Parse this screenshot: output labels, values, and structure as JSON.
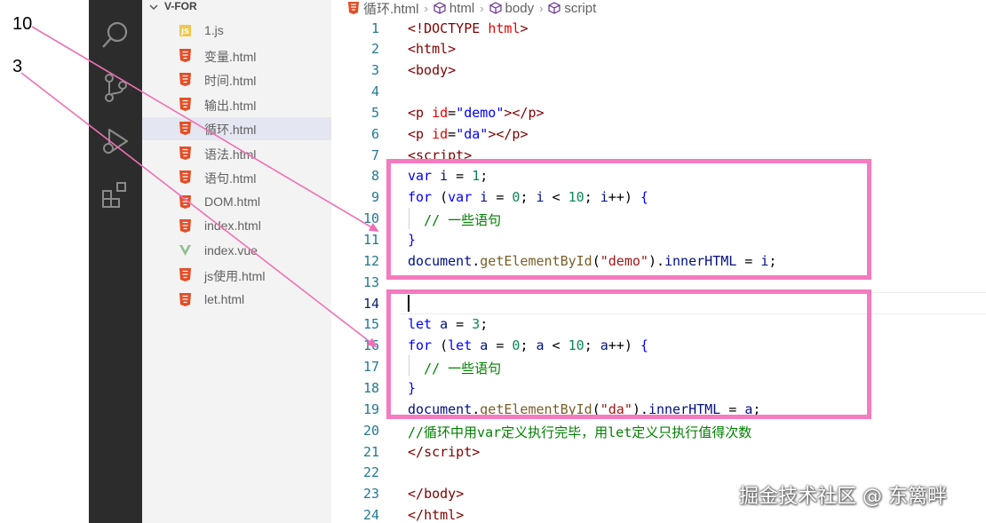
{
  "annotations": {
    "arrow_label_1": "10",
    "arrow_label_2": "3"
  },
  "activity_bar": {
    "icons": [
      "search-icon",
      "source-control-icon",
      "run-debug-icon",
      "extensions-icon"
    ]
  },
  "explorer": {
    "title": "V-FOR",
    "files": [
      {
        "name": "1.js",
        "type": "js"
      },
      {
        "name": "变量.html",
        "type": "html"
      },
      {
        "name": "时间.html",
        "type": "html"
      },
      {
        "name": "输出.html",
        "type": "html"
      },
      {
        "name": "循环.html",
        "type": "html",
        "active": true
      },
      {
        "name": "语法.html",
        "type": "html"
      },
      {
        "name": "语句.html",
        "type": "html"
      },
      {
        "name": "DOM.html",
        "type": "html"
      },
      {
        "name": "index.html",
        "type": "html"
      },
      {
        "name": "index.vue",
        "type": "vue"
      },
      {
        "name": "js使用.html",
        "type": "html"
      },
      {
        "name": "let.html",
        "type": "html"
      }
    ]
  },
  "breadcrumb": {
    "file": "循环.html",
    "crumb1": "html",
    "crumb2": "body",
    "crumb3": "script"
  },
  "editor": {
    "current_line": 14,
    "lines": [
      {
        "n": "1",
        "tokens": [
          [
            "punct",
            "<!"
          ],
          [
            "tag",
            "DOCTYPE "
          ],
          [
            "attr",
            "html"
          ],
          [
            "punct",
            ">"
          ]
        ]
      },
      {
        "n": "2",
        "tokens": [
          [
            "punct",
            "<"
          ],
          [
            "tag",
            "html"
          ],
          [
            "punct",
            ">"
          ]
        ]
      },
      {
        "n": "3",
        "tokens": [
          [
            "punct",
            "<"
          ],
          [
            "tag",
            "body"
          ],
          [
            "punct",
            ">"
          ]
        ]
      },
      {
        "n": "4",
        "tokens": []
      },
      {
        "n": "5",
        "tokens": [
          [
            "punct",
            "<"
          ],
          [
            "tag",
            "p "
          ],
          [
            "attr",
            "id"
          ],
          [
            "plain",
            "="
          ],
          [
            "str",
            "\"demo\""
          ],
          [
            "punct",
            "></"
          ],
          [
            "tag",
            "p"
          ],
          [
            "punct",
            ">"
          ]
        ]
      },
      {
        "n": "6",
        "tokens": [
          [
            "punct",
            "<"
          ],
          [
            "tag",
            "p "
          ],
          [
            "attr",
            "id"
          ],
          [
            "plain",
            "="
          ],
          [
            "str",
            "\"da\""
          ],
          [
            "punct",
            "></"
          ],
          [
            "tag",
            "p"
          ],
          [
            "punct",
            ">"
          ]
        ]
      },
      {
        "n": "7",
        "tokens": [
          [
            "punct",
            "<"
          ],
          [
            "tag",
            "script"
          ],
          [
            "punct",
            ">"
          ]
        ]
      },
      {
        "n": "8",
        "tokens": [
          [
            "kw",
            "var "
          ],
          [
            "var",
            "i"
          ],
          [
            "plain",
            " = "
          ],
          [
            "num",
            "1"
          ],
          [
            "plain",
            ";"
          ]
        ]
      },
      {
        "n": "9",
        "tokens": [
          [
            "kw",
            "for "
          ],
          [
            "plain",
            "("
          ],
          [
            "kw",
            "var "
          ],
          [
            "var",
            "i"
          ],
          [
            "plain",
            " = "
          ],
          [
            "num",
            "0"
          ],
          [
            "plain",
            "; "
          ],
          [
            "var",
            "i"
          ],
          [
            "plain",
            " < "
          ],
          [
            "num",
            "10"
          ],
          [
            "plain",
            "; "
          ],
          [
            "var",
            "i"
          ],
          [
            "plain",
            "++) "
          ],
          [
            "kw",
            "{"
          ]
        ]
      },
      {
        "n": "10",
        "tokens": [
          [
            "plain",
            "  "
          ],
          [
            "cmt",
            "// 一些语句"
          ]
        ]
      },
      {
        "n": "11",
        "tokens": [
          [
            "kw",
            "}"
          ]
        ]
      },
      {
        "n": "12",
        "tokens": [
          [
            "var",
            "document"
          ],
          [
            "plain",
            "."
          ],
          [
            "fn",
            "getElementById"
          ],
          [
            "plain",
            "("
          ],
          [
            "strd",
            "\"demo\""
          ],
          [
            "plain",
            ")."
          ],
          [
            "var",
            "innerHTML"
          ],
          [
            "plain",
            " = "
          ],
          [
            "var",
            "i"
          ],
          [
            "plain",
            ";"
          ]
        ]
      },
      {
        "n": "13",
        "tokens": []
      },
      {
        "n": "14",
        "tokens": []
      },
      {
        "n": "15",
        "tokens": [
          [
            "kw",
            "let "
          ],
          [
            "var",
            "a"
          ],
          [
            "plain",
            " = "
          ],
          [
            "num",
            "3"
          ],
          [
            "plain",
            ";"
          ]
        ]
      },
      {
        "n": "16",
        "tokens": [
          [
            "kw",
            "for "
          ],
          [
            "plain",
            "("
          ],
          [
            "kw",
            "let "
          ],
          [
            "var",
            "a"
          ],
          [
            "plain",
            " = "
          ],
          [
            "num",
            "0"
          ],
          [
            "plain",
            "; "
          ],
          [
            "var",
            "a"
          ],
          [
            "plain",
            " < "
          ],
          [
            "num",
            "10"
          ],
          [
            "plain",
            "; "
          ],
          [
            "var",
            "a"
          ],
          [
            "plain",
            "++) "
          ],
          [
            "kw",
            "{"
          ]
        ]
      },
      {
        "n": "17",
        "tokens": [
          [
            "plain",
            "  "
          ],
          [
            "cmt",
            "// 一些语句"
          ]
        ]
      },
      {
        "n": "18",
        "tokens": [
          [
            "kw",
            "}"
          ]
        ]
      },
      {
        "n": "19",
        "tokens": [
          [
            "var",
            "document"
          ],
          [
            "plain",
            "."
          ],
          [
            "fn",
            "getElementById"
          ],
          [
            "plain",
            "("
          ],
          [
            "strd",
            "\"da\""
          ],
          [
            "plain",
            ")."
          ],
          [
            "var",
            "innerHTML"
          ],
          [
            "plain",
            " = "
          ],
          [
            "var",
            "a"
          ],
          [
            "plain",
            ";"
          ]
        ]
      },
      {
        "n": "20",
        "tokens": [
          [
            "cmt",
            "//循环中用var定义执行完毕，用let定义只执行值得次数"
          ]
        ]
      },
      {
        "n": "21",
        "tokens": [
          [
            "punct",
            "</"
          ],
          [
            "tag",
            "script"
          ],
          [
            "punct",
            ">"
          ]
        ]
      },
      {
        "n": "22",
        "tokens": []
      },
      {
        "n": "23",
        "tokens": [
          [
            "punct",
            "</"
          ],
          [
            "tag",
            "body"
          ],
          [
            "punct",
            ">"
          ]
        ]
      },
      {
        "n": "24",
        "tokens": [
          [
            "punct",
            "</"
          ],
          [
            "tag",
            "html"
          ],
          [
            "punct",
            ">"
          ]
        ]
      }
    ]
  },
  "watermark": "掘金技术社区 @ 东篱畔",
  "colors": {
    "highlight_box": "#f37bbf",
    "arrow": "#f070b4",
    "activity_bar": "#2c2c2c",
    "explorer_bg": "#f3f3f3",
    "line_number": "#237893"
  }
}
